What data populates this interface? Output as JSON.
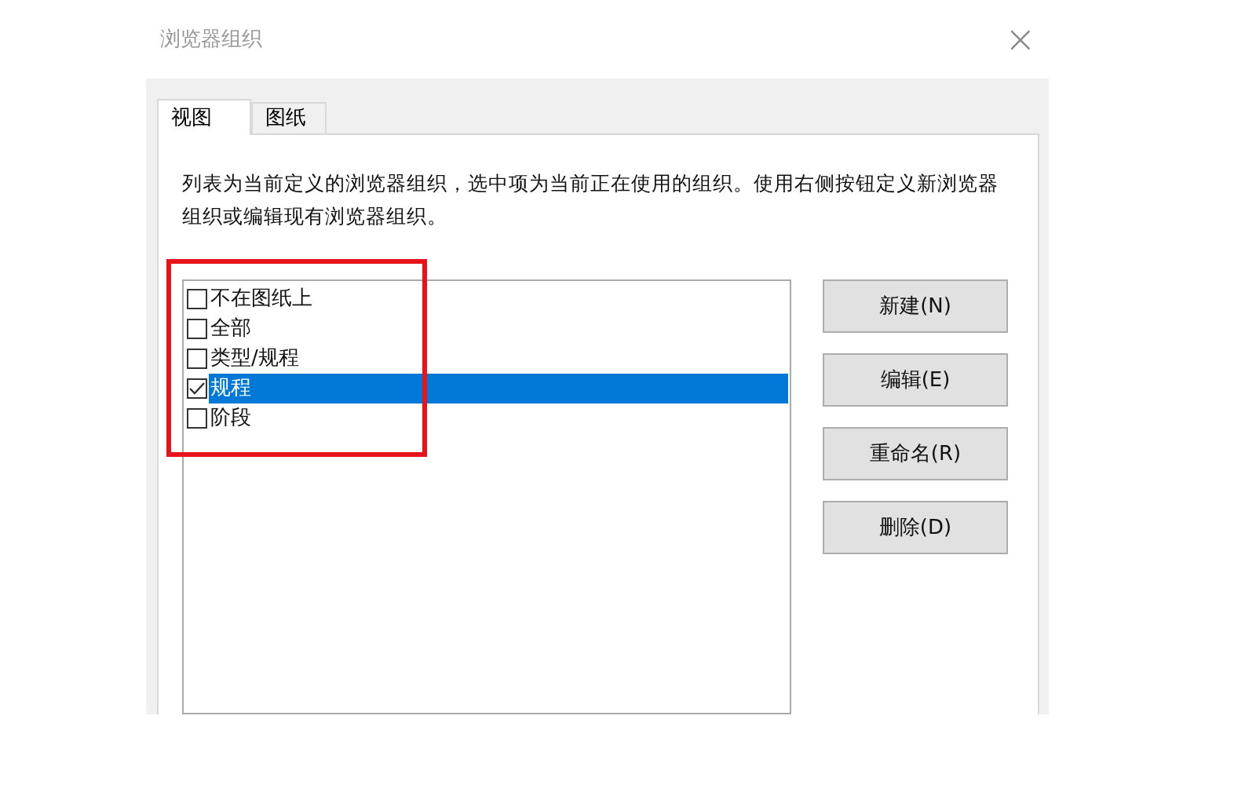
{
  "window": {
    "title": "浏览器组织",
    "close": "×"
  },
  "tabs": [
    {
      "label": "视图",
      "selected": true
    },
    {
      "label": "图纸",
      "selected": false
    }
  ],
  "description": "列表为当前定义的浏览器组织，选中项为当前正在使用的组织。使用右侧按钮定义新浏览器组织或编辑现有浏览器组织。",
  "items": [
    {
      "label": "不在图纸上",
      "checked": false,
      "selected": false
    },
    {
      "label": "全部",
      "checked": false,
      "selected": false
    },
    {
      "label": "类型/规程",
      "checked": false,
      "selected": false
    },
    {
      "label": "规程",
      "checked": true,
      "selected": true
    },
    {
      "label": "阶段",
      "checked": false,
      "selected": false
    }
  ],
  "annotations": [
    {
      "kind": "rectangle"
    }
  ],
  "buttons": [
    "新建(N)",
    "编辑(E)",
    "重命名(R)",
    "删除(D)"
  ]
}
